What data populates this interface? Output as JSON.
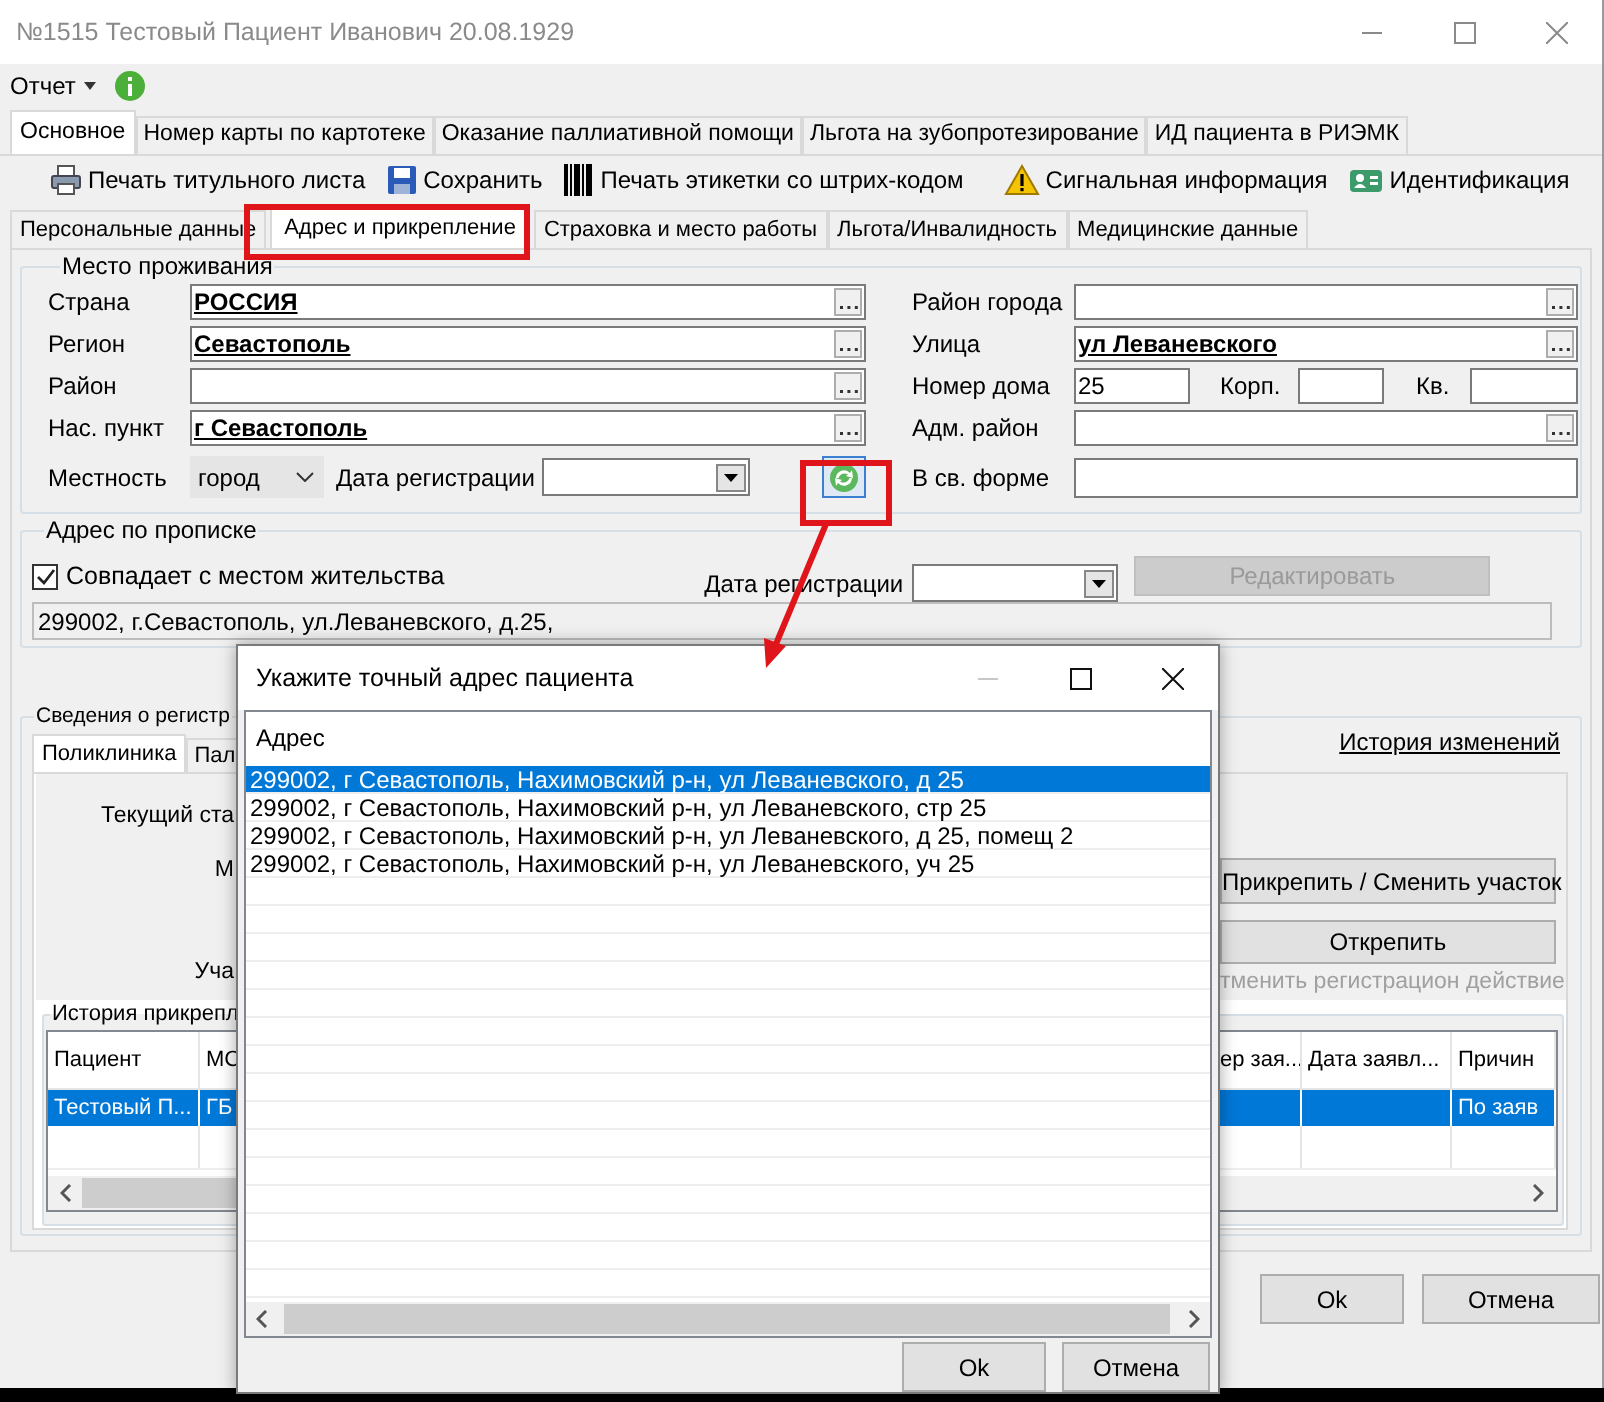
{
  "window": {
    "title": "№1515 Тестовый Пациент Иванович 20.08.1929"
  },
  "menu": [
    {
      "label": "Отчет"
    }
  ],
  "tabs": [
    {
      "label": "Основное",
      "selected": true
    },
    {
      "label": "Номер карты по картотеке",
      "selected": false
    },
    {
      "label": "Оказание паллиативной помощи",
      "selected": false
    },
    {
      "label": "Льгота на зубопротезирование",
      "selected": false
    },
    {
      "label": "ИД пациента в РИЭМК",
      "selected": false
    }
  ],
  "toolbar": [
    {
      "label": "Печать титульного листа",
      "kind": "print"
    },
    {
      "label": "Сохранить",
      "kind": "save"
    },
    {
      "label": "Печать этикетки со штрих-кодом",
      "kind": "barcode"
    },
    {
      "label": "Сигнальная информация",
      "kind": "warning"
    },
    {
      "label": "Идентификация",
      "kind": "id"
    }
  ],
  "subtabs": [
    {
      "label": "Персональные данные",
      "selected": false
    },
    {
      "label": "Адрес и прикрепление",
      "selected": true,
      "highlighted": true
    },
    {
      "label": "Страховка и место работы",
      "selected": false
    },
    {
      "label": "Льгота/Инвалидность",
      "selected": false
    },
    {
      "label": "Медицинские данные",
      "selected": false
    }
  ],
  "residence": {
    "title": "Место проживания",
    "left_fields": [
      {
        "label": "Страна",
        "kind": "lookup",
        "value": "РОССИЯ"
      },
      {
        "label": "Регион",
        "kind": "lookup",
        "value": "Севастополь"
      },
      {
        "label": "Район",
        "kind": "lookup"
      },
      {
        "label": "Нас. пункт",
        "kind": "lookup",
        "value": "г Севастополь"
      }
    ],
    "locality": {
      "label": "Местность",
      "value": "город"
    },
    "registration_date": {
      "label": "Дата регистрации"
    },
    "refresh_highlighted": true,
    "right_fields": [
      {
        "label": "Район города",
        "kind": "lookup"
      },
      {
        "label": "Улица",
        "kind": "lookup",
        "value": "ул Леваневского"
      },
      {
        "label": "Номер дома",
        "kind": "house",
        "value": "25",
        "building_label": "Корп.",
        "apartment_label": "Кв."
      },
      {
        "label": "Адм. район",
        "kind": "lookup"
      },
      {
        "label": "В св. форме",
        "kind": "text"
      }
    ]
  },
  "registration_address": {
    "title": "Адрес по прописке",
    "same_as_residence": {
      "label": "Совпадает с местом жительства",
      "checked": true
    },
    "date_label": "Дата регистрации",
    "edit_button": {
      "label": "Редактировать",
      "disabled": true
    },
    "address": "299002, г.Севастополь, ул.Леваневского, д.25,"
  },
  "attachment": {
    "title": "Сведения о регистр",
    "history_link": "История изменений",
    "tabs": [
      {
        "label": "Поликлиника",
        "selected": true
      },
      {
        "label": "Пал",
        "selected": false
      }
    ],
    "labels": [
      "Текущий ста",
      "М",
      "Уча"
    ],
    "buttons": [
      {
        "label": "Прикрепить / Сменить участок",
        "disabled": false
      },
      {
        "label": "Открепить",
        "disabled": false
      },
      {
        "label": "тменить регистрацион действие",
        "disabled": true
      }
    ],
    "history": {
      "title": "История прикрепл",
      "columns": [
        "Пациент",
        "МС",
        "ер зая...",
        "Дата заявл...",
        "Причин"
      ],
      "rows": [
        {
          "selected": true,
          "cells": [
            "Тестовый П...",
            "ГБ",
            null,
            null,
            "По заяв"
          ]
        }
      ]
    }
  },
  "footer_buttons": [
    "Ok",
    "Отмена"
  ],
  "dialog": {
    "title": "Укажите точный адрес пациента",
    "column": "Адрес",
    "rows": [
      {
        "text": "299002, г Севастополь, Нахимовский р-н, ул Леваневского, д 25",
        "selected": true
      },
      {
        "text": "299002, г Севастополь, Нахимовский р-н, ул Леваневского, стр 25",
        "selected": false
      },
      {
        "text": "299002, г Севастополь, Нахимовский р-н, ул Леваневского, д 25, помещ 2",
        "selected": false
      },
      {
        "text": "299002, г Севастополь, Нахимовский р-н, ул Леваневского, уч 25",
        "selected": false
      }
    ],
    "buttons": [
      "Ok",
      "Отмена"
    ]
  }
}
